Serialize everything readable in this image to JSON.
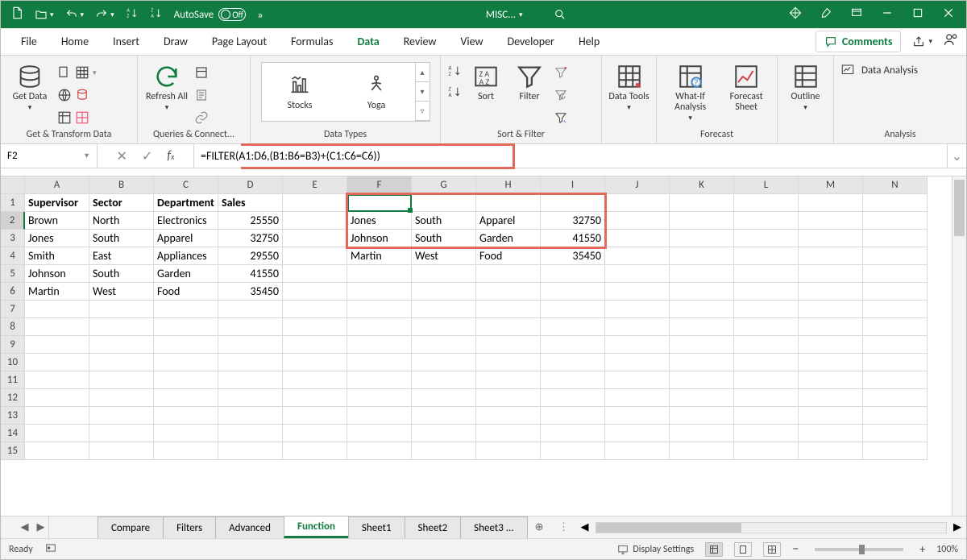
{
  "titlebar": {
    "autosave_label": "AutoSave",
    "autosave_state": "Off",
    "filename": "MISC...",
    "more_glyph": "»"
  },
  "tabs": {
    "items": [
      "File",
      "Home",
      "Insert",
      "Draw",
      "Page Layout",
      "Formulas",
      "Data",
      "Review",
      "View",
      "Developer",
      "Help"
    ],
    "active": "Data",
    "comments": "Comments"
  },
  "ribbon": {
    "group1_label": "Get & Transform Data",
    "get_data": "Get Data",
    "group2_label": "Queries & Connect...",
    "refresh_all": "Refresh All",
    "group3_label": "Data Types",
    "stocks": "Stocks",
    "yoga": "Yoga",
    "group4_label": "Sort & Filter",
    "sort": "Sort",
    "filter": "Filter",
    "group5": "",
    "data_tools": "Data Tools",
    "group6_label": "Forecast",
    "whatif": "What-If Analysis",
    "forecast_sheet": "Forecast Sheet",
    "group7": "",
    "outline": "Outline",
    "group8_label": "Analysis",
    "data_analysis": "Data Analysis"
  },
  "formula_bar": {
    "namebox": "F2",
    "formula": "=FILTER(A1:D6,(B1:B6=B3)+(C1:C6=C6))"
  },
  "columns": [
    "A",
    "B",
    "C",
    "D",
    "E",
    "F",
    "G",
    "H",
    "I",
    "J",
    "K",
    "L",
    "M",
    "N"
  ],
  "rows": [
    "1",
    "2",
    "3",
    "4",
    "5",
    "6",
    "7",
    "8",
    "9",
    "10",
    "11",
    "12",
    "13",
    "14",
    "15"
  ],
  "cells": {
    "A1": "Supervisor",
    "B1": "Sector",
    "C1": "Department",
    "D1": "Sales",
    "A2": "Brown",
    "B2": "North",
    "C2": "Electronics",
    "D2": "25550",
    "A3": "Jones",
    "B3": "South",
    "C3": "Apparel",
    "D3": "32750",
    "A4": "Smith",
    "B4": "East",
    "C4": "Appliances",
    "D4": "29550",
    "A5": "Johnson",
    "B5": "South",
    "C5": "Garden",
    "D5": "41550",
    "A6": "Martin",
    "B6": "West",
    "C6": "Food",
    "D6": "35450",
    "F2": "Jones",
    "G2": "South",
    "H2": "Apparel",
    "I2": "32750",
    "F3": "Johnson",
    "G3": "South",
    "H3": "Garden",
    "I3": "41550",
    "F4": "Martin",
    "G4": "West",
    "H4": "Food",
    "I4": "35450"
  },
  "sheets": {
    "items": [
      "Compare",
      "Filters",
      "Advanced",
      "Function",
      "Sheet1",
      "Sheet2",
      "Sheet3"
    ],
    "active": "Function",
    "more": "..."
  },
  "statusbar": {
    "ready": "Ready",
    "display_settings": "Display Settings",
    "zoom": "100%",
    "minus": "−",
    "plus": "+"
  }
}
